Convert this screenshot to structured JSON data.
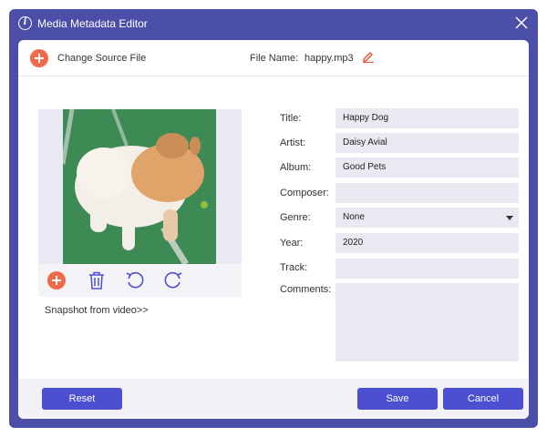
{
  "window": {
    "title": "Media Metadata Editor",
    "title_icon": "info-icon",
    "close_icon": "close-icon"
  },
  "topbar": {
    "change_source_label": "Change Source File",
    "file_name_label": "File Name:",
    "file_name_value": "happy.mp3",
    "edit_icon": "pencil-icon"
  },
  "cover": {
    "image_desc_icon": "cover-image",
    "tools": [
      "add-icon",
      "trash-icon",
      "rotate-left-icon",
      "rotate-right-icon"
    ],
    "snapshot_link": "Snapshot from video>>"
  },
  "fields": {
    "title": {
      "label": "Title:",
      "value": "Happy Dog"
    },
    "artist": {
      "label": "Artist:",
      "value": "Daisy Avial"
    },
    "album": {
      "label": "Album:",
      "value": "Good Pets"
    },
    "composer": {
      "label": "Composer:",
      "value": ""
    },
    "genre": {
      "label": "Genre:",
      "value": "None"
    },
    "year": {
      "label": "Year:",
      "value": "2020"
    },
    "track": {
      "label": "Track:",
      "value": ""
    },
    "comments": {
      "label": "Comments:",
      "value": ""
    }
  },
  "footer": {
    "reset_label": "Reset",
    "save_label": "Save",
    "cancel_label": "Cancel"
  },
  "colors": {
    "accent": "#4c4fcf",
    "frame": "#4c4fa8",
    "add_button": "#f06a4a",
    "input_bg": "#e9e9f1"
  }
}
